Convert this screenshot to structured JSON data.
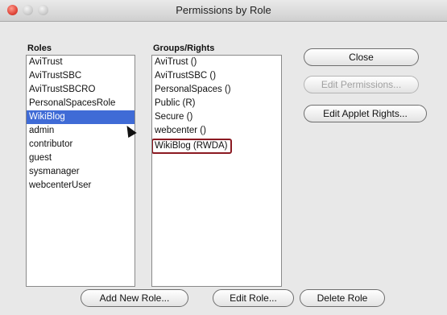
{
  "window": {
    "title": "Permissions by Role"
  },
  "roles": {
    "label": "Roles",
    "items": [
      "AviTrust",
      "AviTrustSBC",
      "AviTrustSBCRO",
      "PersonalSpacesRole",
      "WikiBlog",
      "admin",
      "contributor",
      "guest",
      "sysmanager",
      "webcenterUser"
    ],
    "selected": "WikiBlog"
  },
  "groups": {
    "label": "Groups/Rights",
    "items": [
      "AviTrust ()",
      "AviTrustSBC ()",
      "PersonalSpaces ()",
      "Public (R)",
      "Secure ()",
      "webcenter ()",
      "WikiBlog (RWDA)"
    ],
    "highlighted": "WikiBlog (RWDA)"
  },
  "buttons": {
    "close": "Close",
    "edit_permissions": "Edit Permissions...",
    "edit_applet_rights": "Edit Applet Rights...",
    "add_new_role": "Add New Role...",
    "edit_role": "Edit Role...",
    "delete_role": "Delete Role"
  }
}
